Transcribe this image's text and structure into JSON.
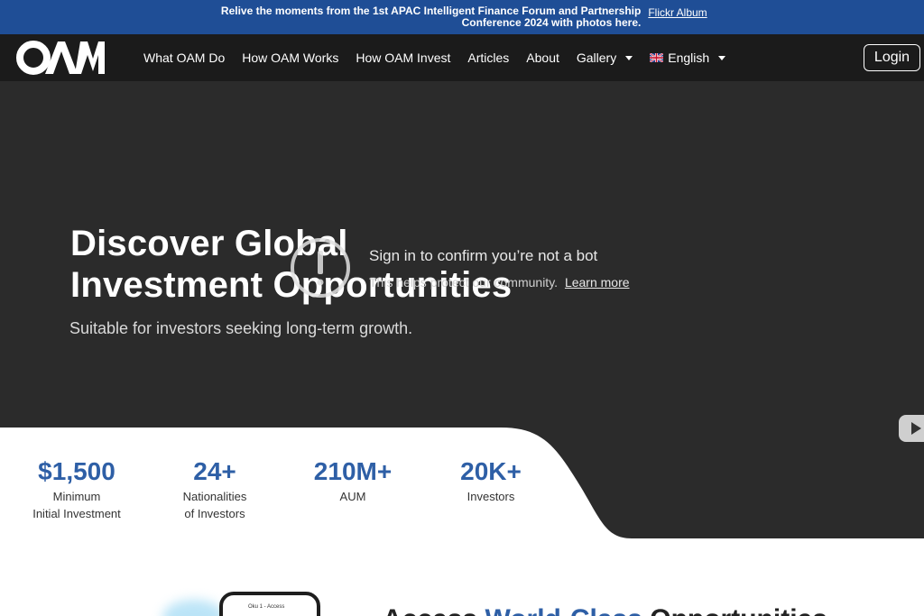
{
  "announcement": {
    "text": "Relive the moments from the 1st APAC Intelligent Finance Forum and Partnership Conference 2024 with photos here.",
    "link": "Flickr Album"
  },
  "nav": {
    "logo_text": "OAM",
    "items": [
      {
        "label": "What OAM Do"
      },
      {
        "label": "How OAM Works"
      },
      {
        "label": "How OAM Invest"
      },
      {
        "label": "Articles"
      },
      {
        "label": "About"
      },
      {
        "label": "Gallery"
      }
    ],
    "language": "English",
    "login": "Login"
  },
  "hero": {
    "title_line1": "Discover Global",
    "title_line2": "Investment Opportunities",
    "subtitle": "Suitable for investors seeking long-term growth."
  },
  "bot_overlay": {
    "title": "Sign in to confirm you’re not a bot",
    "desc": "This helps protect our community.",
    "link": "Learn more"
  },
  "stats": [
    {
      "value": "$1,500",
      "label1": "Minimum",
      "label2": "Initial Investment"
    },
    {
      "value": "24+",
      "label1": "Nationalities",
      "label2": "of Investors"
    },
    {
      "value": "210M+",
      "label1": "AUM",
      "label2": ""
    },
    {
      "value": "20K+",
      "label1": "Investors",
      "label2": ""
    }
  ],
  "lower": {
    "heading_start": "Access ",
    "heading_accent": "World-Class ",
    "heading_end": "Opportunities",
    "phone_text": "Oku 1 - Access"
  },
  "colors": {
    "announce_bg": "#1f4e96",
    "nav_bg": "#1b1b1b",
    "hero_bg": "#2b2b2b",
    "accent": "#2e5fa6"
  }
}
